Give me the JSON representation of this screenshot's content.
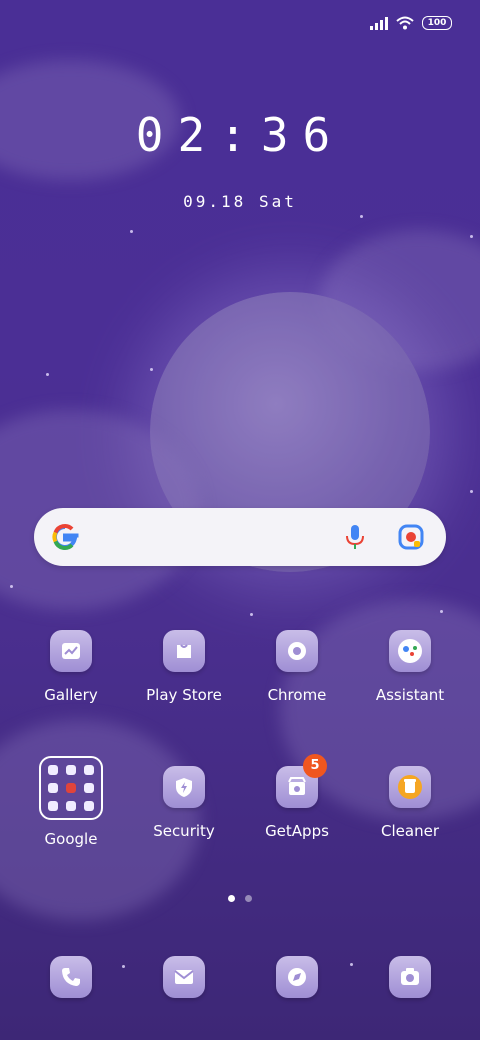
{
  "status_bar": {
    "battery": "100"
  },
  "lock": {
    "time": "02:36",
    "date": "09.18 Sat"
  },
  "apps_row1": [
    {
      "label": "Gallery",
      "icon": "gallery-icon"
    },
    {
      "label": "Play Store",
      "icon": "play-store-icon"
    },
    {
      "label": "Chrome",
      "icon": "chrome-icon"
    },
    {
      "label": "Assistant",
      "icon": "assistant-icon"
    }
  ],
  "apps_row2": [
    {
      "label": "Google",
      "icon": "google-folder"
    },
    {
      "label": "Security",
      "icon": "security-icon"
    },
    {
      "label": "GetApps",
      "icon": "getapps-icon",
      "badge": "5"
    },
    {
      "label": "Cleaner",
      "icon": "cleaner-icon"
    }
  ],
  "dock": [
    {
      "icon": "phone-icon"
    },
    {
      "icon": "messages-icon"
    },
    {
      "icon": "browser-icon"
    },
    {
      "icon": "camera-icon"
    }
  ],
  "colors": {
    "bg": "#4a2f96",
    "badge": "#f0561f",
    "tile": "#c9bde8"
  }
}
